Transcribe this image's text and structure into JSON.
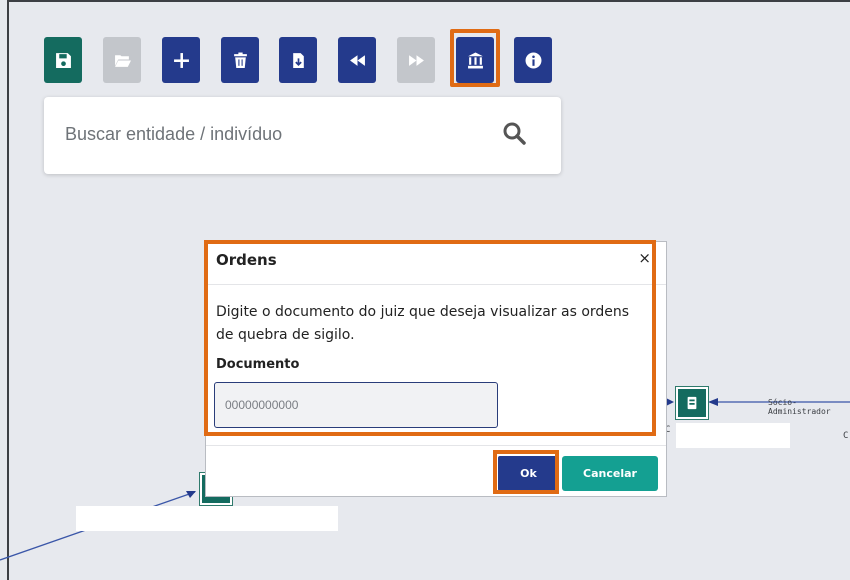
{
  "toolbar": {
    "buttons": [
      {
        "name": "save",
        "icon": "save-icon",
        "color": "#146b5f"
      },
      {
        "name": "open",
        "icon": "folder-open-icon",
        "color": "#c3c6cb"
      },
      {
        "name": "add",
        "icon": "plus-icon",
        "color": "#243a8c"
      },
      {
        "name": "delete",
        "icon": "trash-icon",
        "color": "#243a8c"
      },
      {
        "name": "export",
        "icon": "file-download-icon",
        "color": "#243a8c"
      },
      {
        "name": "back",
        "icon": "backward-icon",
        "color": "#243a8c"
      },
      {
        "name": "forward",
        "icon": "forward-icon",
        "color": "#c3c6cb"
      },
      {
        "name": "orders",
        "icon": "bank-icon",
        "color": "#243a8c"
      },
      {
        "name": "info",
        "icon": "info-icon",
        "color": "#243a8c"
      }
    ]
  },
  "search": {
    "placeholder": "Buscar entidade / indivíduo",
    "icon": "search-icon"
  },
  "graph": {
    "edge_label": "Sócio-Administrador",
    "fragment_1": "C",
    "fragment_2": "C"
  },
  "modal": {
    "title": "Ordens",
    "close": "×",
    "message": "Digite o documento do juiz que deseja visualizar as ordens de quebra de sigilo.",
    "field_label": "Documento",
    "field_placeholder": "00000000000",
    "ok_label": "Ok",
    "cancel_label": "Cancelar"
  },
  "colors": {
    "highlight": "#e06b14",
    "primary_blue": "#243a8c",
    "primary_green": "#146b5f",
    "teal": "#14a092"
  }
}
